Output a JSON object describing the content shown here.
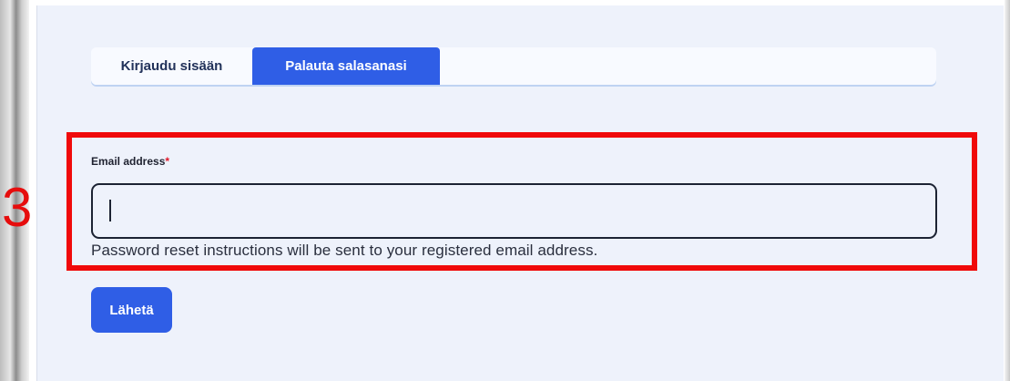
{
  "tabs": [
    {
      "label": "Kirjaudu sisään",
      "active": false
    },
    {
      "label": "Palauta salasanasi",
      "active": true
    }
  ],
  "form": {
    "email_label": "Email address",
    "required_marker": "*",
    "email_value": "",
    "helper_text": "Password reset instructions will be sent to your registered email address.",
    "submit_label": "Lähetä"
  },
  "annotation": {
    "number": "3",
    "color": "#f00a0a"
  },
  "colors": {
    "accent": "#2f5ee6",
    "card_background": "#eef2fb",
    "required": "#e1192b"
  }
}
